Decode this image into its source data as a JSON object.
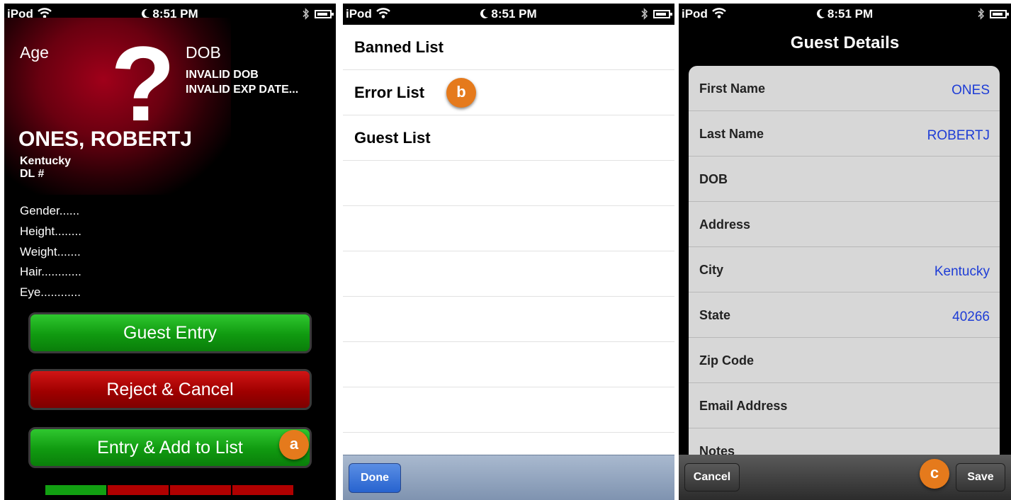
{
  "status_bar": {
    "carrier": "iPod",
    "time": "8:51 PM"
  },
  "panel1": {
    "age_label": "Age",
    "dob_label": "DOB",
    "question_mark": "?",
    "invalid_dob": "INVALID DOB",
    "invalid_exp": "INVALID EXP DATE...",
    "name": "ONES, ROBERTJ",
    "state": "Kentucky",
    "dl": "DL #",
    "fields": [
      "Gender......",
      "Height........",
      "Weight.......",
      "Hair............",
      "Eye............"
    ],
    "guest_entry_label": "Guest Entry",
    "reject_label": "Reject & Cancel",
    "entry_add_label": "Entry & Add to List",
    "badge": "a",
    "colors": {
      "green": "#109a10",
      "red": "#a00000"
    }
  },
  "panel2": {
    "items": [
      "Banned List",
      "Error  List",
      "Guest List"
    ],
    "badge": "b",
    "done_label": "Done"
  },
  "panel3": {
    "title": "Guest Details",
    "rows": [
      {
        "label": "First Name",
        "value": "ONES"
      },
      {
        "label": "Last Name",
        "value": "ROBERTJ"
      },
      {
        "label": "DOB",
        "value": ""
      },
      {
        "label": "Address",
        "value": ""
      },
      {
        "label": "City",
        "value": "Kentucky"
      },
      {
        "label": "State",
        "value": "40266"
      },
      {
        "label": "Zip Code",
        "value": ""
      },
      {
        "label": "Email Address",
        "value": ""
      },
      {
        "label": "Notes",
        "value": ""
      }
    ],
    "cancel_label": "Cancel",
    "save_label": "Save",
    "badge": "c",
    "value_color": "#1d3cd6"
  }
}
